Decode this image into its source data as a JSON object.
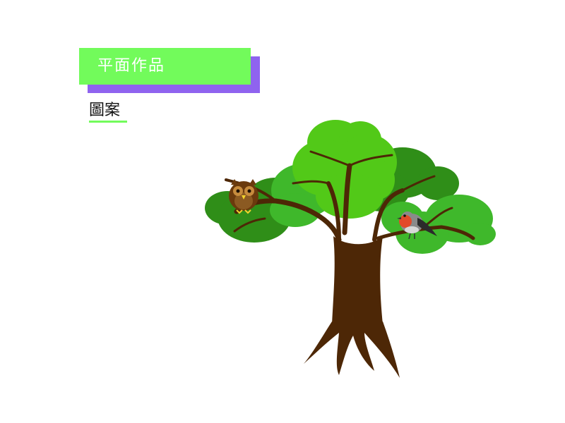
{
  "banner": {
    "title": "平面作品"
  },
  "section": {
    "subtitle": "圖案"
  },
  "colors": {
    "banner_green": "#72fb5b",
    "banner_purple": "#8f63ef",
    "trunk_brown": "#4d2706",
    "foliage_dark": "#2f8e18",
    "foliage_mid": "#3fb82b",
    "foliage_light": "#52c918"
  },
  "artwork": {
    "subject": "tree-illustration",
    "icons": [
      "owl-icon",
      "robin-bird-icon"
    ]
  }
}
